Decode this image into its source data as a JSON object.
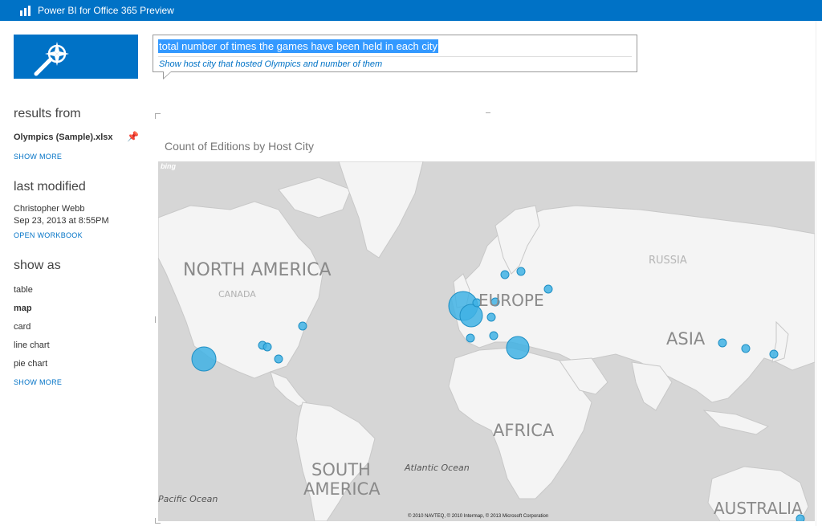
{
  "app": {
    "title": "Power BI for Office 365 Preview"
  },
  "query": {
    "text": "total number of times the games have been held in each city",
    "suggestion": "Show host city that hosted Olympics and number of them"
  },
  "sidebar": {
    "results_heading": "results from",
    "source_file": "Olympics (Sample).xlsx",
    "show_more_1": "SHOW MORE",
    "modified_heading": "last modified",
    "modified_by": "Christopher Webb",
    "modified_date": "Sep 23, 2013 at 8:55PM",
    "open_workbook": "OPEN WORKBOOK",
    "show_as_heading": "show as",
    "show_as_items": [
      "table",
      "map",
      "card",
      "line chart",
      "pie chart"
    ],
    "selected_item": "map",
    "show_more_2": "SHOW MORE"
  },
  "visual": {
    "title": "Count of Editions by Host City",
    "provider": "bing",
    "labels": {
      "north_america": "NORTH AMERICA",
      "europe": "EUROPE",
      "asia": "ASIA",
      "africa": "AFRICA",
      "south_america_1": "SOUTH",
      "south_america_2": "AMERICA",
      "australia": "AUSTRALIA",
      "russia": "RUSSIA",
      "canada": "CANADA",
      "atlantic": "Atlantic Ocean",
      "pacific": "Pacific Ocean"
    },
    "credit": "© 2010 NAVTEQ, © 2010 Intermap, © 2013 Microsoft Corporation"
  },
  "colors": {
    "accent": "#0072c6",
    "bubble": "#3fb2e4",
    "bubble_stroke": "#1f8fc4"
  }
}
